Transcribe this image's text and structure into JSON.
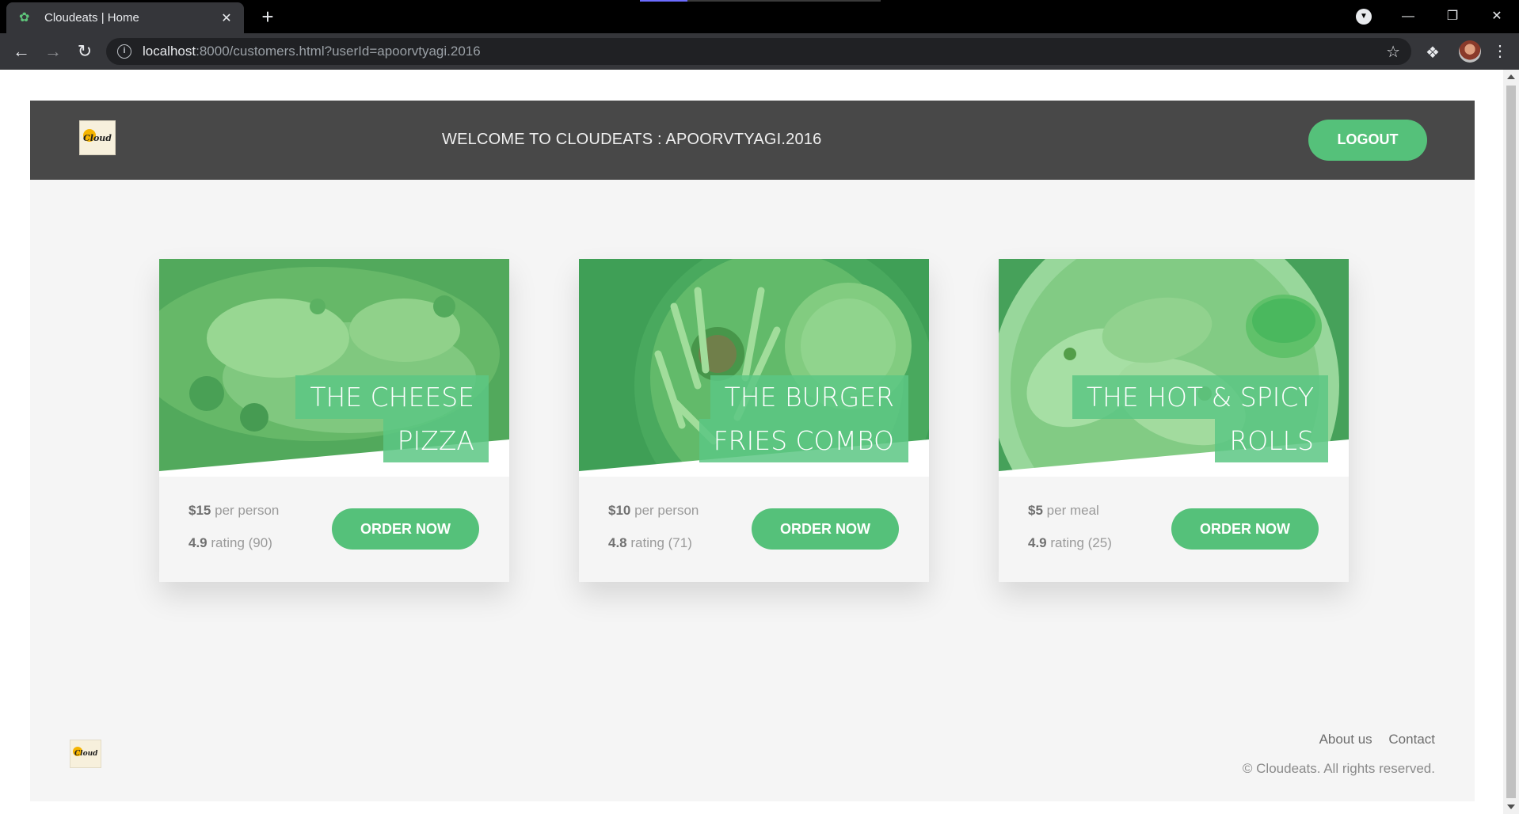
{
  "browser": {
    "tab_title": "Cloudeats | Home",
    "url_host": "localhost",
    "url_rest": ":8000/customers.html?userId=apoorvtyagi.2016"
  },
  "header": {
    "logo_text": "Cloud",
    "welcome": "WELCOME TO CLOUDEATS : APOORVTYAGI.2016",
    "logout_label": "LOGOUT"
  },
  "cards": [
    {
      "name_line1": "THE CHEESE",
      "name_line2": "PIZZA",
      "price": "$15",
      "price_unit": "per person",
      "rating": "4.9",
      "rating_text": "rating (90)",
      "order_label": "ORDER NOW"
    },
    {
      "name_line1": "THE BURGER",
      "name_line2": "FRIES COMBO",
      "price": "$10",
      "price_unit": "per person",
      "rating": "4.8",
      "rating_text": "rating (71)",
      "order_label": "ORDER NOW"
    },
    {
      "name_line1": "THE HOT & SPICY",
      "name_line2": "ROLLS",
      "price": "$5",
      "price_unit": "per meal",
      "rating": "4.9",
      "rating_text": "rating (25)",
      "order_label": "ORDER NOW"
    }
  ],
  "footer": {
    "logo_text": "Cloud",
    "about": "About us",
    "contact": "Contact",
    "copyright": "© Cloudeats. All rights reserved."
  },
  "colors": {
    "accent_green": "#55c17a",
    "header_bg": "#484848",
    "page_bg": "#f5f5f5"
  }
}
